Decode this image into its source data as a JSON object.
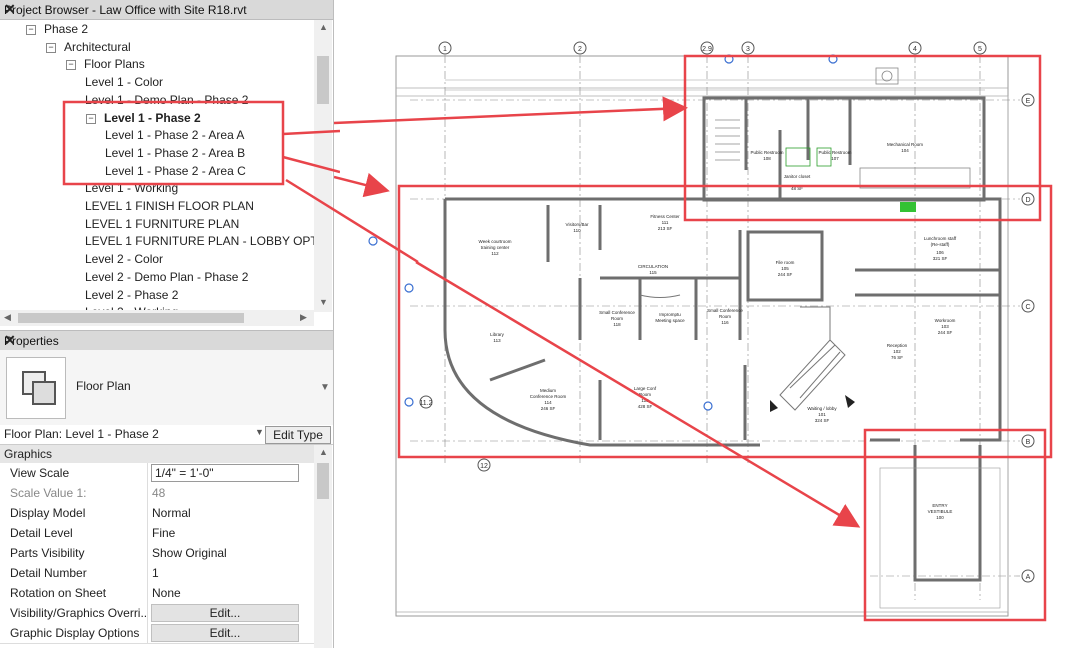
{
  "project_browser": {
    "title": "Project Browser - Law Office with Site R18.rvt",
    "close": "✕",
    "items": [
      {
        "label": "Phase 2",
        "indent": 1,
        "toggle": "−"
      },
      {
        "label": "Architectural",
        "indent": 2,
        "toggle": "−"
      },
      {
        "label": "Floor Plans",
        "indent": 3,
        "toggle": "−"
      },
      {
        "label": "Level 1 - Color",
        "indent": 4
      },
      {
        "label": "Level 1 - Demo Plan - Phase 2",
        "indent": 4
      },
      {
        "label": "Level 1 - Phase 2",
        "indent": 4,
        "toggle": "−",
        "bold": true
      },
      {
        "label": "Level 1 - Phase 2 - Area A",
        "indent": 5
      },
      {
        "label": "Level 1 - Phase 2 - Area B",
        "indent": 5
      },
      {
        "label": "Level 1 - Phase 2 - Area C",
        "indent": 5
      },
      {
        "label": "Level 1 - Working",
        "indent": 4
      },
      {
        "label": "LEVEL 1 FINISH FLOOR PLAN",
        "indent": 4
      },
      {
        "label": "LEVEL 1 FURNITURE PLAN",
        "indent": 4
      },
      {
        "label": "LEVEL 1 FURNITURE PLAN - LOBBY OPT",
        "indent": 4
      },
      {
        "label": "Level 2 - Color",
        "indent": 4
      },
      {
        "label": "Level 2 - Demo Plan - Phase 2",
        "indent": 4
      },
      {
        "label": "Level 2 - Phase 2",
        "indent": 4
      },
      {
        "label": "Level 2 - Working",
        "indent": 4
      }
    ]
  },
  "properties": {
    "title": "Properties",
    "close": "✕",
    "type_name": "Floor Plan",
    "selector": "Floor Plan: Level 1 - Phase 2",
    "edit_type": "Edit Type",
    "category": "Graphics",
    "rows": [
      {
        "key": "View Scale",
        "value": "1/4\" = 1'-0\"",
        "style": "box"
      },
      {
        "key": "Scale Value    1:",
        "value": "48",
        "style": "gray"
      },
      {
        "key": "Display Model",
        "value": "Normal"
      },
      {
        "key": "Detail Level",
        "value": "Fine"
      },
      {
        "key": "Parts Visibility",
        "value": "Show Original"
      },
      {
        "key": "Detail Number",
        "value": "1"
      },
      {
        "key": "Rotation on Sheet",
        "value": "None"
      },
      {
        "key": "Visibility/Graphics Overri...",
        "value": "Edit...",
        "style": "btn"
      },
      {
        "key": "Graphic Display Options",
        "value": "Edit...",
        "style": "btn"
      }
    ]
  },
  "plan": {
    "grid_top": [
      "1",
      "2",
      "2.9",
      "3",
      "4",
      "5"
    ],
    "grid_right": [
      "E",
      "D",
      "C",
      "B",
      "A"
    ],
    "grid_left": [
      "11.2",
      "12"
    ],
    "rooms": [
      {
        "name": "Public Restroom",
        "num": "108"
      },
      {
        "name": "Public Restroom",
        "num": "107"
      },
      {
        "name": "Mechanical Room",
        "num": "104"
      },
      {
        "name": "Janitor closet",
        "num": "",
        "area": "48 SF"
      },
      {
        "name": "Visitors/Bar",
        "num": "110"
      },
      {
        "name": "Fitness Center",
        "num": "111",
        "area": "213 SF"
      },
      {
        "name": "Week courtroom training center",
        "num": "112"
      },
      {
        "name": "CIRCULATION",
        "num": "115"
      },
      {
        "name": "File room",
        "num": "105",
        "area": "244 SF"
      },
      {
        "name": "Lunchroom staff (Re-staff)",
        "num": "106",
        "area": "321 SF"
      },
      {
        "name": "Small Conference Room",
        "num": "118"
      },
      {
        "name": "Impromptu Meeting space",
        "num": "117"
      },
      {
        "name": "Small Conference Room",
        "num": "116"
      },
      {
        "name": "Library",
        "num": "113"
      },
      {
        "name": "Workroom",
        "num": "103",
        "area": "244 SF"
      },
      {
        "name": "Reception",
        "num": "102",
        "area": "76 SF"
      },
      {
        "name": "Medium Conference Room",
        "num": "114",
        "area": "246 SF"
      },
      {
        "name": "Large Conf Room",
        "num": "115",
        "area": "428 SF"
      },
      {
        "name": "Waiting / lobby",
        "num": "101",
        "area": "324 SF"
      },
      {
        "name": "ENTRY VESTIBULE",
        "num": "100"
      }
    ]
  },
  "colors": {
    "callout": "#e8444a",
    "wall": "#6e6e6e",
    "accent_blue": "#3a6fd1"
  }
}
